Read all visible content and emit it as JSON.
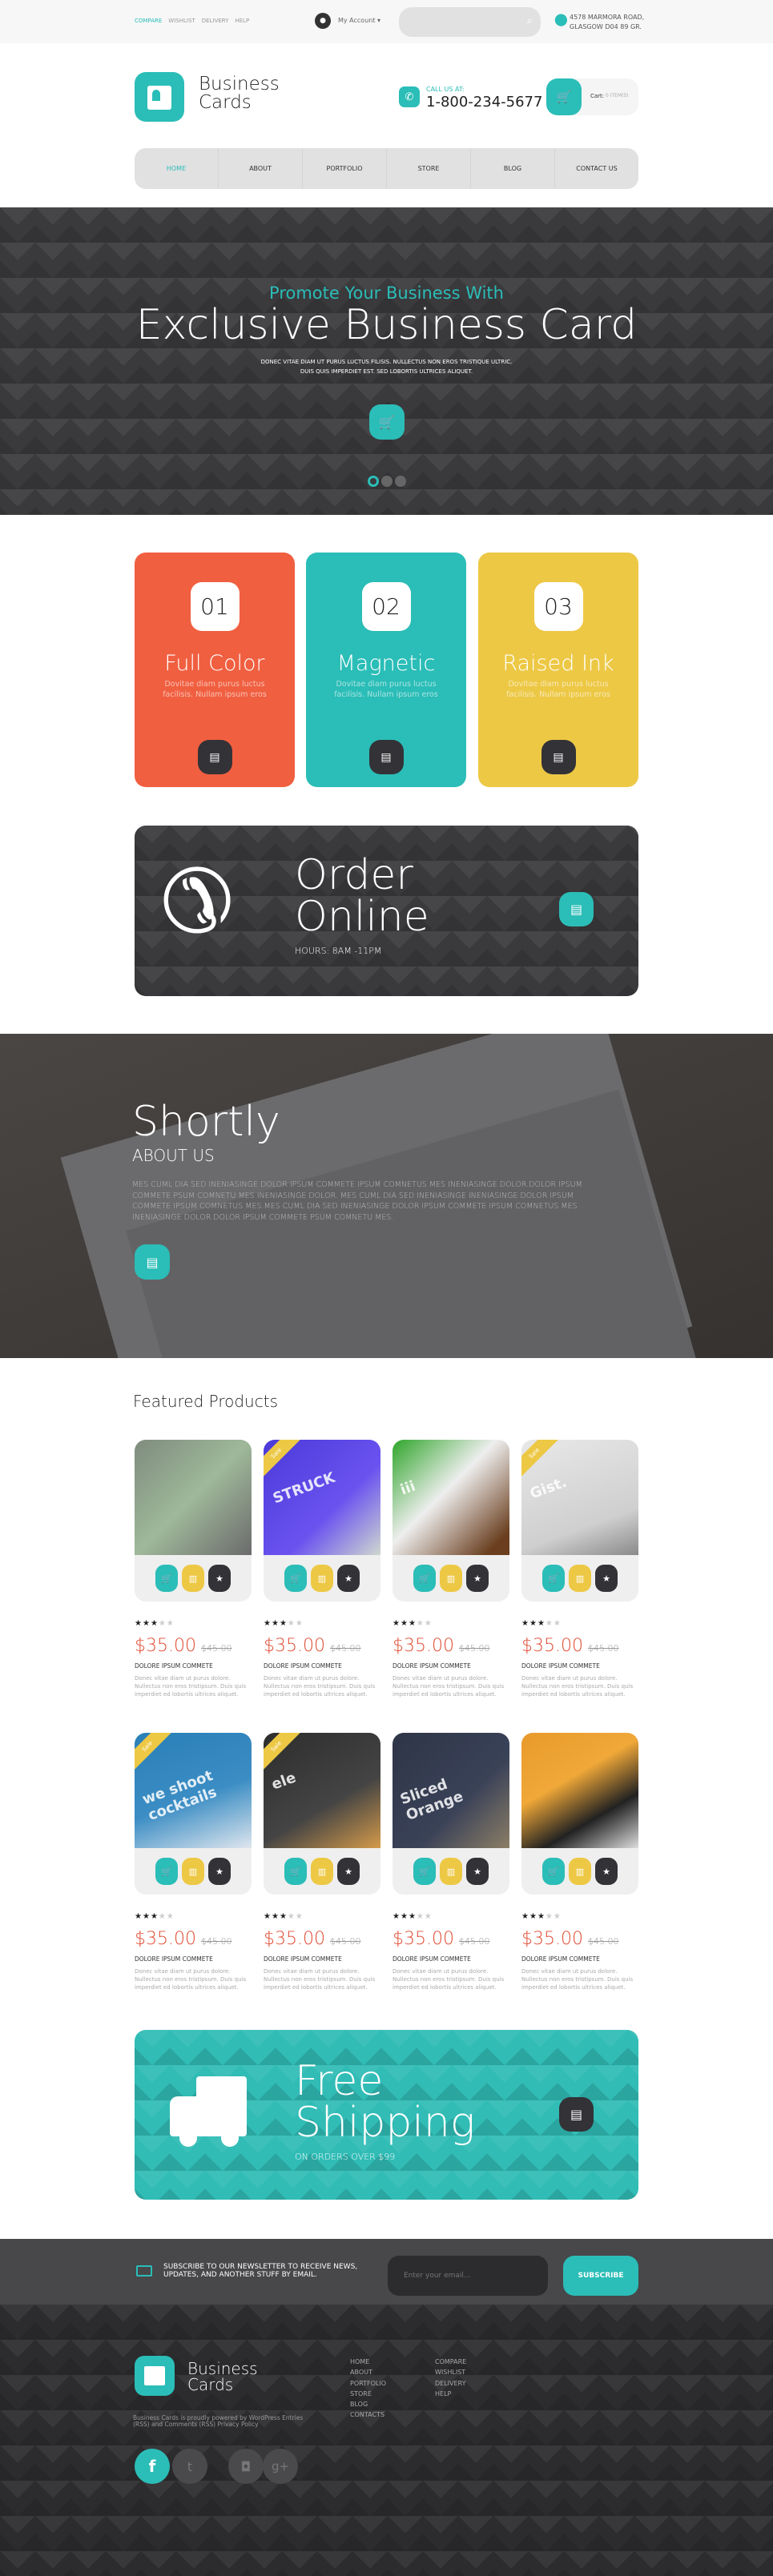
{
  "topbar": {
    "links": [
      "COMPARE",
      "WISHLIST",
      "DELIVERY",
      "HELP"
    ],
    "account": "My Account",
    "search_placeholder": "",
    "address_line1": "4578 MARMORA ROAD,",
    "address_line2": "GLASGOW D04 89 GR."
  },
  "header": {
    "logo_line1": "Business",
    "logo_line2": "Cards",
    "call_label": "CALL US AT:",
    "phone": "1-800-234-5677",
    "cart_label": "Cart:",
    "cart_count": "0 ITEM(S)"
  },
  "nav": [
    "HOME",
    "ABOUT",
    "PORTFOLIO",
    "STORE",
    "BLOG",
    "CONTACT US"
  ],
  "hero": {
    "kicker": "Promote Your Business With",
    "title": "Exclusive Business Card",
    "text1": "DONEC VITAE DIAM UT PURUS LUCTUS FILISIS. NULLECTUS NON EROS TRISTIQUE ULTRIC.",
    "text2": "DUIS QUIS IMPERDIET EST. SED LOBORTIS ULTRICES ALIQUET.",
    "slides": 3,
    "active_slide": 1
  },
  "features": [
    {
      "num": "01",
      "title": "Full Color",
      "desc": "Dovitae diam purus luctus facilisis. Nullam  ipsum eros",
      "color": "#f05f40"
    },
    {
      "num": "02",
      "title": "Magnetic",
      "desc": "Dovitae diam purus luctus facilisis. Nullam  ipsum eros",
      "color": "#2bbdb7"
    },
    {
      "num": "03",
      "title": "Raised Ink",
      "desc": "Dovitae diam purus luctus facilisis. Nullam  ipsum eros",
      "color": "#edc845"
    }
  ],
  "order": {
    "line1": "Order",
    "line2": "Online",
    "hours": "HOURS: 8AM -11PM"
  },
  "about": {
    "title": "Shortly",
    "subtitle": "ABOUT US",
    "text": "MES CUML DIA SED INENIASINGE DOLOR IPSUM COMMETE IPSUM COMNETUS MES INENIASINGE DOLOR.DOLOR IPSUM COMMETE PSUM COMNETU MES INENIASINGE DOLOR. MES CUML DIA SED INENIASINGE INENIASINGE DOLOR IPSUM COMMETE IPSUM COMNETUS MES.MES CUML DIA SED INENIASINGE DOLOR IPSUM COMMETE IPSUM COMNETUS MES INENIASINGE DOLOR.DOLOR IPSUM COMMETE PSUM COMNETU MES."
  },
  "featured": {
    "heading": "Featured Products",
    "sale_label": "Sale",
    "products": [
      {
        "image_text": "",
        "bg": "linear-gradient(135deg,#7f8c7e,#9fb89a 50%,#6b6b6b)",
        "sale": false,
        "rating": 3,
        "price": "$35.00",
        "old_price": "$45.00",
        "name": "DOLORE IPSUM COMMETE",
        "desc": "Donec vitae diam ut purus dolore. Nullectus non eros tristipsum. Duis quis imperdiet ed lobortis ultrices aliquet."
      },
      {
        "image_text": "STRUCK",
        "bg": "linear-gradient(135deg,#4a3ad8,#6a52f0 60%,#cfd7cf)",
        "sale": true,
        "rating": 3,
        "price": "$35.00",
        "old_price": "$45.00",
        "name": "DOLORE IPSUM COMMETE",
        "desc": "Donec vitae diam ut purus dolore. Nullectus non eros tristipsum. Duis quis imperdiet ed lobortis ultrices aliquet."
      },
      {
        "image_text": "iii",
        "bg": "linear-gradient(135deg,#2fa52a,#eee 45%,#6a3e1e 90%)",
        "sale": false,
        "rating": 3,
        "price": "$35.00",
        "old_price": "$45.00",
        "name": "DOLORE IPSUM COMMETE",
        "desc": "Donec vitae diam ut purus dolore. Nullectus non eros tristipsum. Duis quis imperdiet ed lobortis ultrices aliquet."
      },
      {
        "image_text": "Gist.",
        "bg": "linear-gradient(160deg,#e8e8e8,#cfcfcf 70%,#8a8a8a)",
        "sale": true,
        "rating": 3,
        "price": "$35.00",
        "old_price": "$45.00",
        "name": "DOLORE IPSUM COMMETE",
        "desc": "Donec vitae diam ut purus dolore. Nullectus non eros tristipsum. Duis quis imperdiet ed lobortis ultrices aliquet."
      },
      {
        "image_text": "we shoot cocktails",
        "bg": "linear-gradient(160deg,#2a7fb8,#3b8dc4 55%,#dfe6ee)",
        "sale": true,
        "rating": 3,
        "price": "$35.00",
        "old_price": "$45.00",
        "name": "DOLORE IPSUM COMMETE",
        "desc": "Donec vitae diam ut purus dolore. Nullectus non eros tristipsum. Duis quis imperdiet ed lobortis ultrices aliquet."
      },
      {
        "image_text": "ele",
        "bg": "linear-gradient(150deg,#2d2d2d,#444 60%,#d49a4a)",
        "sale": true,
        "rating": 3,
        "price": "$35.00",
        "old_price": "$45.00",
        "name": "DOLORE IPSUM COMMETE",
        "desc": "Donec vitae diam ut purus dolore. Nullectus non eros tristipsum. Duis quis imperdiet ed lobortis ultrices aliquet."
      },
      {
        "image_text": "Sliced Orange",
        "bg": "linear-gradient(135deg,#2e3548,#3a4258 60%,#8c7e66)",
        "sale": false,
        "rating": 3,
        "price": "$35.00",
        "old_price": "$45.00",
        "name": "DOLORE IPSUM COMMETE",
        "desc": "Donec vitae diam ut purus dolore. Nullectus non eros tristipsum. Duis quis imperdiet ed lobortis ultrices aliquet."
      },
      {
        "image_text": "",
        "bg": "linear-gradient(150deg,#e89a2a,#f0a838 40%,#222 70%,#ddd)",
        "sale": false,
        "rating": 3,
        "price": "$35.00",
        "old_price": "$45.00",
        "name": "DOLORE IPSUM COMMETE",
        "desc": "Donec vitae diam ut purus dolore. Nullectus non eros tristipsum. Duis quis imperdiet ed lobortis ultrices aliquet."
      }
    ]
  },
  "shipping": {
    "line1": "Free",
    "line2": "Shipping",
    "sub": "ON ORDERS OVER $99"
  },
  "newsletter": {
    "text1": "SUBSCRIBE TO OUR NEWSLETTER TO RECEIVE NEWS,",
    "text2": "UPDATES, AND ANOTHER STUFF BY EMAIL.",
    "placeholder": "Enter your email...",
    "button": "SUBSCRIBE"
  },
  "footer": {
    "logo_line1": "Business",
    "logo_line2": "Cards",
    "powered1": "Business Cards is proudly powered by WordPress Entries",
    "powered2": "(RSS) and Comments (RSS) Privacy Policy",
    "col1": [
      "HOME",
      "ABOUT",
      "PORTFOLIO",
      "STORE",
      "BLOG",
      "CONTACTS"
    ],
    "col2": [
      "COMPARE",
      "WISHLIST",
      "DELIVERY",
      "HELP"
    ],
    "social": [
      "facebook",
      "twitter",
      "instagram",
      "google-plus"
    ]
  },
  "colors": {
    "teal": "#2bbdb7",
    "orange": "#f05f40",
    "yellow": "#edc845",
    "dark": "#333237",
    "price": "#e04b33"
  }
}
